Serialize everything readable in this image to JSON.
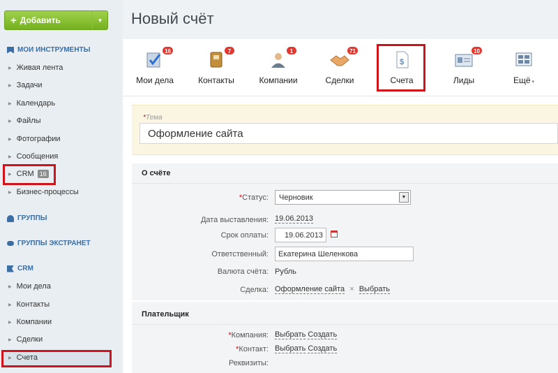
{
  "sidebar": {
    "add_button": "Добавить",
    "sections": {
      "tools": "МОИ ИНСТРУМЕНТЫ",
      "groups": "ГРУППЫ",
      "extranet": "ГРУППЫ ЭКСТРАНЕТ",
      "crm": "CRM"
    },
    "tools_items": [
      "Живая лента",
      "Задачи",
      "Календарь",
      "Файлы",
      "Фотографии",
      "Сообщения",
      "CRM",
      "Бизнес-процессы"
    ],
    "crm_badge": "16",
    "crm_items": [
      "Мои дела",
      "Контакты",
      "Компании",
      "Сделки",
      "Счета"
    ]
  },
  "page": {
    "title": "Новый счёт"
  },
  "tabs": [
    {
      "label": "Мои дела",
      "count": "16"
    },
    {
      "label": "Контакты",
      "count": "7"
    },
    {
      "label": "Компании",
      "count": "1"
    },
    {
      "label": "Сделки",
      "count": "71"
    },
    {
      "label": "Счета",
      "count": ""
    },
    {
      "label": "Лиды",
      "count": "10"
    },
    {
      "label": "Ещё",
      "count": ""
    }
  ],
  "theme": {
    "label": "Тема",
    "required": "*",
    "value": "Оформление сайта"
  },
  "about": {
    "title": "О счёте",
    "status_label": "Статус:",
    "status_value": "Черновик",
    "date_label": "Дата выставления:",
    "date_value": "19.06.2013",
    "due_label": "Срок оплаты:",
    "due_value": "19.06.2013",
    "responsible_label": "Ответственный:",
    "responsible_value": "Екатерина Шеленкова",
    "currency_label": "Валюта счёта:",
    "currency_value": "Рубль",
    "deal_label": "Сделка:",
    "deal_value": "Оформление сайта",
    "deal_remove": "×",
    "deal_choose": "Выбрать"
  },
  "payer": {
    "title": "Плательщик",
    "company_label": "Компания:",
    "contact_label": "Контакт:",
    "choose": "Выбрать",
    "create": "Создать",
    "requisites_label": "Реквизиты:"
  },
  "colors": {
    "accent_red": "#d0121a",
    "green": "#74b11f",
    "link_blue": "#3a6ea5"
  }
}
